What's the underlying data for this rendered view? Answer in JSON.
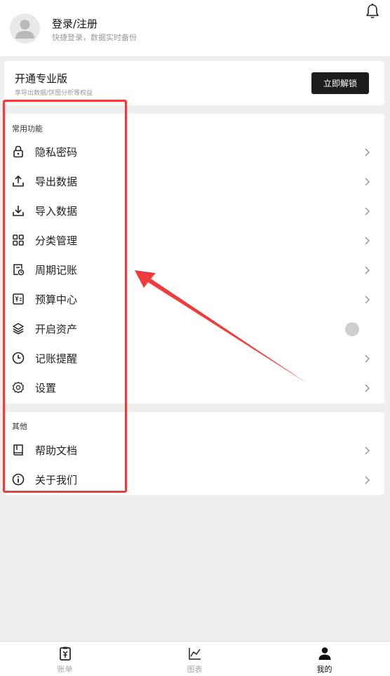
{
  "user": {
    "name": "登录/注册",
    "subtitle": "快捷登录，数据实时备份"
  },
  "pro": {
    "title": "开通专业版",
    "subtitle": "享导出数据/饼图分析等权益",
    "button": "立即解锁"
  },
  "sections": {
    "common": {
      "title": "常用功能",
      "items": [
        {
          "label": "隐私密码",
          "icon": "lock-icon"
        },
        {
          "label": "导出数据",
          "icon": "upload-icon"
        },
        {
          "label": "导入数据",
          "icon": "download-icon"
        },
        {
          "label": "分类管理",
          "icon": "grid-icon"
        },
        {
          "label": "周期记账",
          "icon": "calendar-clock-icon"
        },
        {
          "label": "预算中心",
          "icon": "budget-icon"
        },
        {
          "label": "开启资产",
          "icon": "layers-icon",
          "control": "toggle",
          "enabled": false
        },
        {
          "label": "记账提醒",
          "icon": "clock-icon"
        },
        {
          "label": "设置",
          "icon": "gear-icon"
        }
      ]
    },
    "other": {
      "title": "其他",
      "items": [
        {
          "label": "帮助文档",
          "icon": "book-icon"
        },
        {
          "label": "关于我们",
          "icon": "info-icon"
        }
      ]
    }
  },
  "tabbar": [
    {
      "label": "账单",
      "icon": "bill-icon",
      "active": false
    },
    {
      "label": "图表",
      "icon": "chart-icon",
      "active": false
    },
    {
      "label": "我的",
      "icon": "person-icon",
      "active": true
    }
  ],
  "colors": {
    "accent_dark": "#1d1d1d",
    "highlight": "#ee3b3b",
    "background": "#efefef"
  }
}
